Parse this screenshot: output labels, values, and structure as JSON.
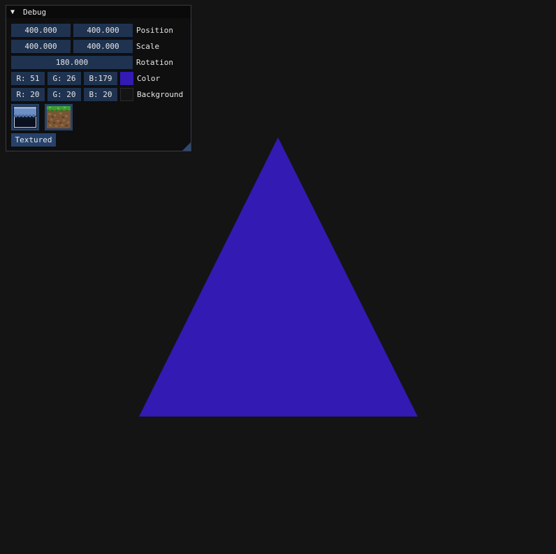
{
  "colors": {
    "background": "#141414",
    "triangle": "#331ab3",
    "background_swatch": "#141414",
    "field_bg": "#1f3350",
    "button_bg": "#26426b"
  },
  "debug_window": {
    "title": "Debug",
    "collapse_icon": "triangle-down",
    "position": {
      "x": "400.000",
      "y": "400.000",
      "label": "Position"
    },
    "scale": {
      "x": "400.000",
      "y": "400.000",
      "label": "Scale"
    },
    "rotation": {
      "value": "180.000",
      "label": "Rotation"
    },
    "color": {
      "r": "R: 51",
      "g": "G: 26",
      "b": "B:179",
      "label": "Color"
    },
    "background": {
      "r": "R: 20",
      "g": "G: 20",
      "b": "B: 20",
      "label": "Background"
    },
    "textures": [
      "window-curtain-texture",
      "grass-dirt-block-texture"
    ],
    "textured_button": "Textured"
  }
}
